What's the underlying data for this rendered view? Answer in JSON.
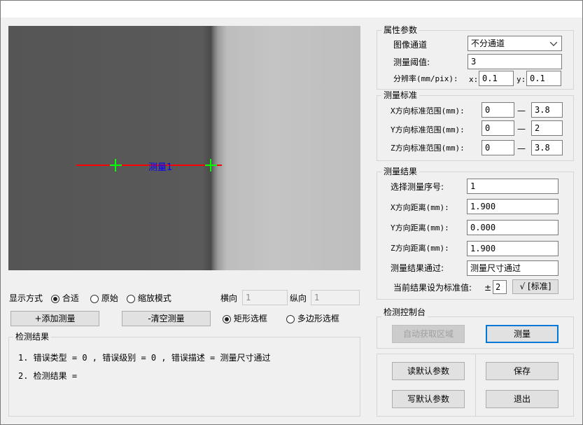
{
  "canvas": {
    "measure_label": "测量1"
  },
  "display_mode": {
    "label": "显示方式",
    "options": [
      {
        "label": "合适",
        "selected": true
      },
      {
        "label": "原始",
        "selected": false
      },
      {
        "label": "缩放模式",
        "selected": false
      }
    ],
    "horizontal_label": "横向",
    "horizontal_value": "1",
    "vertical_label": "纵向",
    "vertical_value": "1"
  },
  "actions": {
    "add_measure": "+添加测量",
    "clear_measure": "-清空测量"
  },
  "selection_mode": [
    {
      "label": "矩形选框",
      "selected": true
    },
    {
      "label": "多边形选框",
      "selected": false
    }
  ],
  "results": {
    "title": "检测结果",
    "lines": [
      "1. 错误类型 = 0 , 错误级别 = 0 , 错误描述 = 测量尺寸通过",
      "2. 检测结果 ="
    ]
  },
  "props": {
    "title": "属性参数",
    "channel_label": "图像通道",
    "channel_value": "不分通道",
    "threshold_label": "测量阈值:",
    "threshold_value": "3",
    "resolution_label": "分辨率(mm/pix):",
    "x_label": "x:",
    "x_value": "0.1",
    "y_label": "y:",
    "y_value": "0.1"
  },
  "standard": {
    "title": "测量标准",
    "rows": [
      {
        "label": "X方向标准范围(mm):",
        "min": "0",
        "max": "3.8"
      },
      {
        "label": "Y方向标准范围(mm):",
        "min": "0",
        "max": "2"
      },
      {
        "label": "Z方向标准范围(mm):",
        "min": "0",
        "max": "3.8"
      }
    ],
    "dash": "—"
  },
  "measure_result": {
    "title": "测量结果",
    "rows": [
      {
        "label": "选择测量序号:",
        "value": "1"
      },
      {
        "label": "X方向距离(mm):",
        "value": "1.900"
      },
      {
        "label": "Y方向距离(mm):",
        "value": "0.000"
      },
      {
        "label": "Z方向距离(mm):",
        "value": "1.900"
      },
      {
        "label": "测量结果通过:",
        "value": "测量尺寸通过"
      }
    ],
    "set_std_label": "当前结果设为标准值:",
    "pm": "±",
    "tolerance": "2",
    "set_std_button": "√ [标准]"
  },
  "control": {
    "title": "检测控制台",
    "auto_region": "自动获取区域",
    "measure": "测量"
  },
  "footer": {
    "read_default": "读默认参数",
    "save": "保存",
    "write_default": "写默认参数",
    "exit": "退出"
  },
  "colors": {
    "measure_line": "#ff0000",
    "cross": "#00ff00",
    "label": "#0000ff",
    "focus": "#0078d7"
  }
}
